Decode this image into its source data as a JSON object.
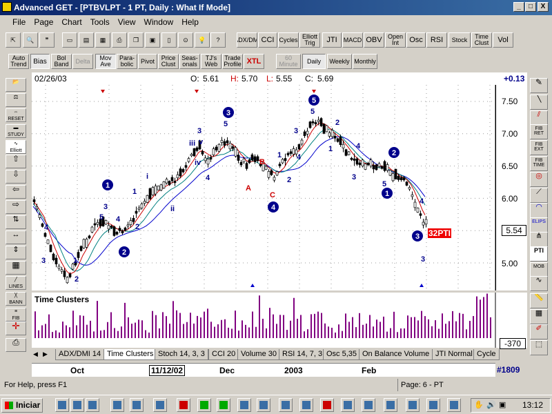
{
  "window": {
    "title": "Advanced GET - [PTBVLPT - 1 PT, Daily : What If Mode]",
    "buttons": [
      "_",
      "□",
      "X"
    ]
  },
  "menu": [
    "File",
    "Page",
    "Chart",
    "Tools",
    "View",
    "Window",
    "Help"
  ],
  "toolbar1": [
    "ADX/DMI",
    "CCI",
    "Cycles",
    "Elliott Trig",
    "JTI",
    "MACD",
    "OBV",
    "Open Int",
    "Osc",
    "RSI",
    "Stock",
    "Time Clust",
    "Vol"
  ],
  "toolbar2": [
    "Auto Trend",
    "Bias",
    "Bol Band",
    "Delta",
    "Mov Ave",
    "Para-bolic",
    "Pivot",
    "Price Clust",
    "Seas-onals",
    "TJ's Web",
    "Trade Profile",
    "XTL",
    "60 Minute",
    "Daily",
    "Weekly",
    "Monthly"
  ],
  "chart_info": {
    "date": "02/26/03",
    "open_label": "O:",
    "open": "5.61",
    "high_label": "H:",
    "high": "5.70",
    "low_label": "L:",
    "low": "5.55",
    "close_label": "C:",
    "close": "5.69",
    "change": "+0.13"
  },
  "price_axis": [
    "7.50",
    "7.00",
    "6.50",
    "6.00",
    "5.50",
    "5.00"
  ],
  "last_price": "5.54",
  "pti_label": "32PTI",
  "subchart": {
    "title": "Time Clusters",
    "value": "-370"
  },
  "tabs": [
    "ADX/DMI 14",
    "Time Clusters",
    "Stoch 14, 3, 3",
    "CCI 20",
    "Volume 30",
    "RSI 14, 7, 3",
    "Osc 5,35",
    "On Balance Volume",
    "JTI Normal",
    "Cycle"
  ],
  "date_axis": [
    "Oct",
    "11/12/02",
    "Dec",
    "2003",
    "Feb"
  ],
  "bar_count": "#1809",
  "status": {
    "help": "For Help, press F1",
    "page": "Page: 6 - PT"
  },
  "left_toolbar": [
    "RESET",
    "STUDY",
    "Elliott",
    "LINES",
    "BANN",
    "FIB"
  ],
  "right_toolbar": [
    "FIB RET",
    "FIB EXT",
    "FIB TIME",
    "ELIPS",
    "PTI",
    "MOB"
  ],
  "taskbar": {
    "start": "Iniciar",
    "clock": "13:12"
  },
  "elliott_labels": {
    "c3a": "3",
    "c5a": "5",
    "c3b": "3",
    "c4": "4",
    "c1": "1",
    "c2": "2",
    "c2b": "2",
    "c5c": "5",
    "iii": "iii",
    "v": "v",
    "iv": "iv",
    "ii": "ii",
    "i": "i",
    "A": "A",
    "B": "B",
    "C": "C",
    "d4": "4",
    "e1": "1",
    "e3": "3",
    "e5": "5",
    "f1": "1",
    "f2": "2",
    "f3": "3",
    "f4": "4",
    "f5": "5",
    "g1": "1",
    "g2": "2",
    "g3": "3",
    "g4": "4",
    "g5": "5",
    "h1": "1",
    "h3": "3",
    "h4": "4"
  },
  "colors": {
    "title": "#0a246a",
    "wave": "#00008b",
    "correction": "#cc0000",
    "ma1": "#cc0000",
    "ma2": "#008080",
    "ma3": "#0000cc",
    "cluster": "#800080"
  }
}
